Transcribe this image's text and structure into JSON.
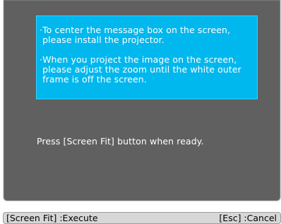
{
  "message_box": {
    "lines_1": [
      "·To center the message box on the screen,",
      " please install the projector."
    ],
    "lines_2": [
      "·When you project the image on the screen,",
      " please adjust the zoom until the white outer",
      " frame is off the screen."
    ]
  },
  "ready_prompt": "Press [Screen Fit] button when ready.",
  "footer": {
    "execute_label": "[Screen Fit] :Execute",
    "cancel_label": "[Esc] :Cancel"
  },
  "colors": {
    "panel": "#606060",
    "message_box": "#00b7ee",
    "footer_bar": "#d7d7d7"
  }
}
